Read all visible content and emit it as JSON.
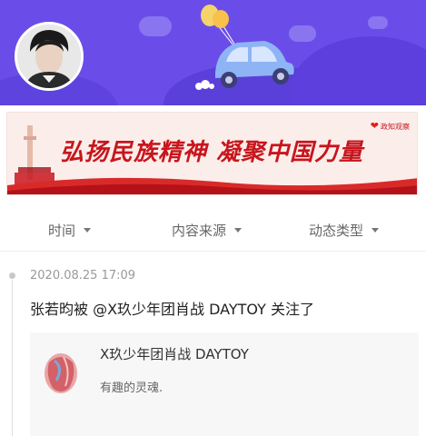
{
  "header": {
    "avatar_icon": "profile-avatar",
    "illustration_icon": "car-with-balloons"
  },
  "banner": {
    "slogan": "弘扬民族精神 凝聚中国力量",
    "brand": "政知观察",
    "colors": {
      "red": "#c8151d",
      "background": "#fbeeea"
    }
  },
  "filters": [
    {
      "label": "时间"
    },
    {
      "label": "内容来源"
    },
    {
      "label": "动态类型"
    }
  ],
  "feed": {
    "timestamp": "2020.08.25 17:09",
    "activity_text": "张若昀被 @X玖少年团肖战 DAYTOY 关注了",
    "card": {
      "title": "X玖少年团肖战 DAYTOY",
      "description": "有趣的灵魂."
    }
  },
  "theme": {
    "header_purple": "#6a4de8"
  }
}
